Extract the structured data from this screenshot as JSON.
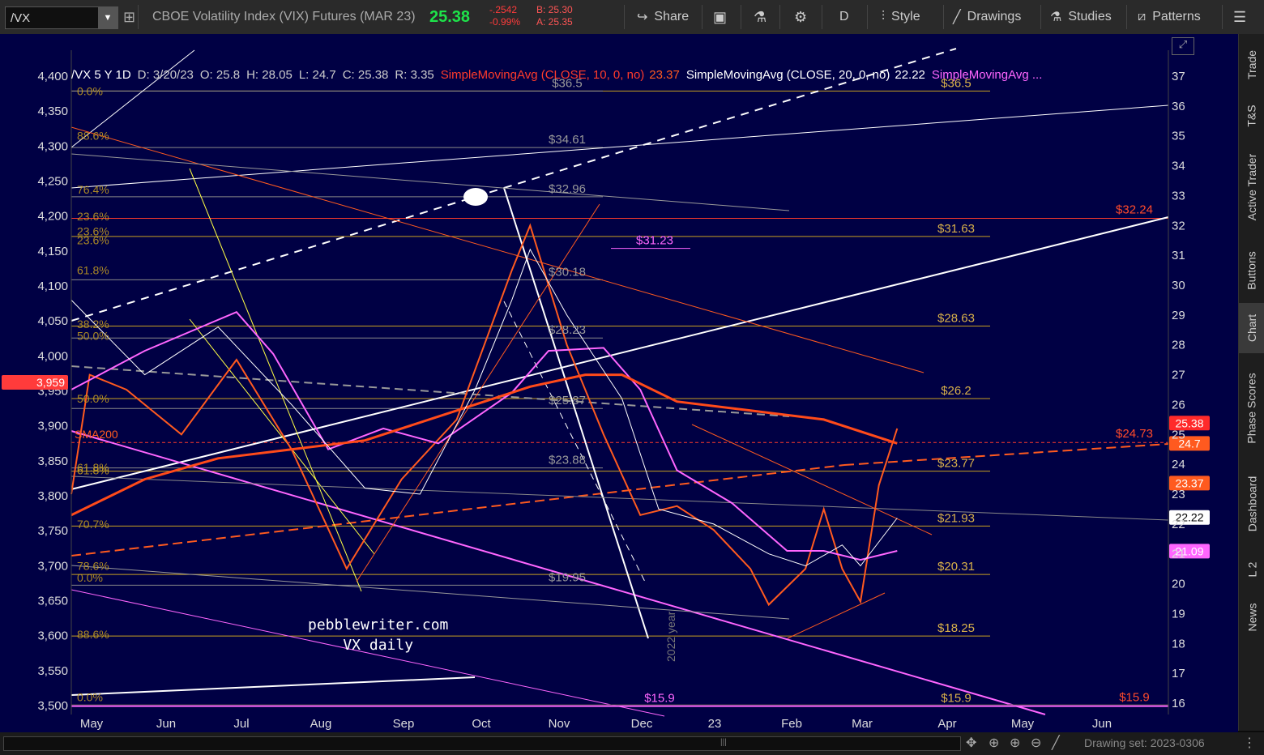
{
  "toolbar": {
    "symbol": "/VX",
    "instrument": "CBOE Volatility Index (VIX) Futures (MAR 23)",
    "last": "25.38",
    "change": "-.2542",
    "change_pct": "-0.99%",
    "bid": "B: 25.30",
    "ask": "A: 25.35",
    "share": "Share",
    "period": "D",
    "style": "Style",
    "drawings": "Drawings",
    "studies": "Studies",
    "patterns": "Patterns"
  },
  "info": {
    "symbol_period": "/VX 5 Y 1D",
    "date": "D: 3/20/23",
    "open": "O: 25.8",
    "high": "H: 28.05",
    "low": "L: 24.7",
    "close": "C: 25.38",
    "range": "R: 3.35",
    "sma10_label": "SimpleMovingAvg (CLOSE, 10, 0, no)",
    "sma10_val": "23.37",
    "sma20_label": "SimpleMovingAvg (CLOSE, 20, 0, no)",
    "sma20_val": "22.22",
    "sma3_label": "SimpleMovingAvg ..."
  },
  "sidebar": [
    "Trade",
    "T&S",
    "Active Trader",
    "Buttons",
    "Chart",
    "Phase Scores",
    "Dashboard",
    "L 2",
    "News"
  ],
  "bottom": {
    "drawing_set": "Drawing set: 2023-0306"
  },
  "colors": {
    "bg": "#000044",
    "orange": "#ff5a1f",
    "pink": "#ff66ff",
    "gold": "#d4a017",
    "white": "#ffffff",
    "gray": "#9a9a9a"
  },
  "watermark": {
    "line1": "pebblewriter.com",
    "line2": "VX daily"
  },
  "year_marker": "2022 year",
  "sma200_tag": "SMA200",
  "chart_data": {
    "type": "line",
    "x_tick_labels": [
      "May",
      "Jun",
      "Jul",
      "Aug",
      "Sep",
      "Oct",
      "Nov",
      "Dec",
      "23",
      "Feb",
      "Mar",
      "Apr",
      "May",
      "Jun"
    ],
    "left_axis": {
      "ticks": [
        "4,400",
        "4,350",
        "4,300",
        "4,250",
        "4,200",
        "4,150",
        "4,100",
        "4,050",
        "4,000",
        "3,950",
        "3,900",
        "3,850",
        "3,800",
        "3,750",
        "3,700",
        "3,650",
        "3,600",
        "3,550",
        "3,500"
      ],
      "highlight": "3,959"
    },
    "right_axis": {
      "ticks": [
        37,
        36,
        35,
        34,
        33,
        32,
        31,
        30,
        29,
        28,
        27,
        26,
        25,
        24,
        23,
        22,
        21,
        20,
        19,
        18,
        17,
        16
      ],
      "ylim": [
        16,
        37
      ]
    },
    "right_price_labels": [
      {
        "value": "25.38",
        "color": "#ff2a2a",
        "y": 25.38
      },
      {
        "value": "24.7",
        "color": "#ff5a1f",
        "y": 24.7
      },
      {
        "value": "23.37",
        "color": "#ff5a1f",
        "y": 23.37
      },
      {
        "value": "22.22",
        "color": "#ffffff",
        "y": 22.22
      },
      {
        "value": "21.09",
        "color": "#ff66ff",
        "y": 21.09
      }
    ],
    "gold_levels": [
      {
        "label": "$36.5",
        "y": 36.5
      },
      {
        "label": "$31.63",
        "y": 31.63
      },
      {
        "label": "$28.63",
        "y": 28.63
      },
      {
        "label": "$26.2",
        "y": 26.2
      },
      {
        "label": "$23.77",
        "y": 23.77
      },
      {
        "label": "$21.93",
        "y": 21.93
      },
      {
        "label": "$20.31",
        "y": 20.31
      },
      {
        "label": "$18.25",
        "y": 18.25
      },
      {
        "label": "$15.9",
        "y": 15.9
      }
    ],
    "gray_levels": [
      {
        "label": "$36.5",
        "y": 36.5
      },
      {
        "label": "$34.61",
        "y": 34.61
      },
      {
        "label": "$32.96",
        "y": 32.96
      },
      {
        "label": "$30.18",
        "y": 30.18
      },
      {
        "label": "$28.23",
        "y": 28.23
      },
      {
        "label": "$25.87",
        "y": 25.87
      },
      {
        "label": "$23.88",
        "y": 23.88
      },
      {
        "label": "$19.95",
        "y": 19.95
      }
    ],
    "red_levels": [
      {
        "label": "$32.24",
        "y": 32.24
      },
      {
        "label": "$24.73",
        "y": 24.73
      },
      {
        "label": "$15.9",
        "y": 15.9
      }
    ],
    "pink_levels": [
      {
        "label": "$31.23",
        "y": 31.23
      },
      {
        "label": "$15.9",
        "y": 15.9
      }
    ],
    "fib_labels": [
      {
        "label": "0.0%",
        "y": 36.5
      },
      {
        "label": "88.6%",
        "y": 35.0
      },
      {
        "label": "76.4%",
        "y": 33.2
      },
      {
        "label": "23.6%",
        "y": 32.3
      },
      {
        "label": "23.6%",
        "y": 31.8
      },
      {
        "label": "23.6%",
        "y": 31.5
      },
      {
        "label": "61.8%",
        "y": 30.5
      },
      {
        "label": "38.2%",
        "y": 28.7
      },
      {
        "label": "50.0%",
        "y": 28.3
      },
      {
        "label": "50.0%",
        "y": 26.2
      },
      {
        "label": "61.8%",
        "y": 23.9
      },
      {
        "label": "61.8%",
        "y": 23.8
      },
      {
        "label": "70.7%",
        "y": 22.0
      },
      {
        "label": "78.6%",
        "y": 20.6
      },
      {
        "label": "0.0%",
        "y": 20.2
      },
      {
        "label": "88.6%",
        "y": 18.3
      },
      {
        "label": "0.0%",
        "y": 16.2
      }
    ],
    "series": [
      {
        "color": "#ff5a1f",
        "values": [
          [
            0,
            23
          ],
          [
            1,
            27
          ],
          [
            3,
            26.5
          ],
          [
            6,
            25
          ],
          [
            9,
            27.5
          ],
          [
            12,
            24.5
          ],
          [
            15,
            20.5
          ],
          [
            18,
            23.5
          ],
          [
            21,
            25.5
          ],
          [
            24,
            30.5
          ],
          [
            25,
            32
          ],
          [
            27,
            28
          ],
          [
            29,
            25
          ],
          [
            31,
            22.3
          ],
          [
            33,
            22.6
          ],
          [
            35,
            21.8
          ],
          [
            37,
            20.5
          ],
          [
            38,
            19.3
          ],
          [
            40,
            20.5
          ],
          [
            41,
            22.5
          ],
          [
            42,
            20.5
          ],
          [
            43,
            19.4
          ],
          [
            44,
            23.3
          ],
          [
            45,
            25.2
          ]
        ]
      },
      {
        "color": "#ff66ff",
        "values": [
          [
            0,
            26.5
          ],
          [
            4,
            27.8
          ],
          [
            9,
            29.1
          ],
          [
            11,
            27.7
          ],
          [
            14,
            24.5
          ],
          [
            17,
            25.2
          ],
          [
            20,
            24.7
          ],
          [
            24,
            26.4
          ],
          [
            26,
            27.8
          ],
          [
            29,
            27.9
          ],
          [
            31,
            26.5
          ],
          [
            33,
            23.8
          ],
          [
            36,
            22.7
          ],
          [
            39,
            21.1
          ],
          [
            41,
            21.1
          ],
          [
            43,
            20.8
          ],
          [
            45,
            21.1
          ]
        ]
      },
      {
        "color": "#ff4a1a",
        "values": [
          [
            0,
            22.3
          ],
          [
            4,
            23.5
          ],
          [
            8,
            24.2
          ],
          [
            12,
            24.5
          ],
          [
            16,
            24.8
          ],
          [
            20,
            25.6
          ],
          [
            25,
            26.6
          ],
          [
            28,
            27
          ],
          [
            30,
            27
          ],
          [
            33,
            26.1
          ],
          [
            37,
            25.8
          ],
          [
            41,
            25.5
          ],
          [
            45,
            24.7
          ]
        ]
      },
      {
        "color": "#ffffff",
        "values": [
          [
            0,
            29.5
          ],
          [
            4,
            27
          ],
          [
            8,
            28.6
          ],
          [
            12,
            26
          ],
          [
            16,
            23.2
          ],
          [
            19,
            23
          ],
          [
            22,
            26.5
          ],
          [
            24,
            29.5
          ],
          [
            25,
            31.2
          ],
          [
            27,
            29
          ],
          [
            30,
            26.2
          ],
          [
            32,
            22.5
          ],
          [
            35,
            22
          ],
          [
            38,
            21
          ],
          [
            40,
            20.6
          ],
          [
            42,
            21.3
          ],
          [
            43,
            20.6
          ],
          [
            45,
            22.2
          ]
        ]
      }
    ]
  }
}
